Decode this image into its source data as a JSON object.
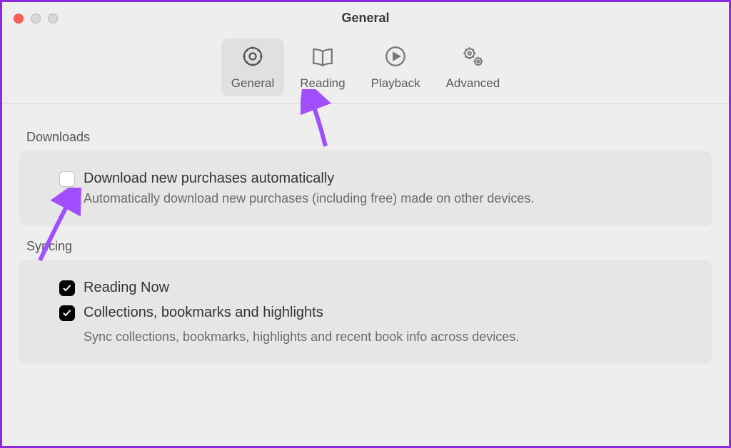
{
  "window": {
    "title": "General"
  },
  "tabs": {
    "general": "General",
    "reading": "Reading",
    "playback": "Playback",
    "advanced": "Advanced"
  },
  "sections": {
    "downloads": {
      "title": "Downloads",
      "option": "Download new purchases automatically",
      "description": "Automatically download new purchases (including free) made on other devices."
    },
    "syncing": {
      "title": "Syncing",
      "readingNow": "Reading Now",
      "collections": "Collections, bookmarks and highlights",
      "description": "Sync collections, bookmarks, highlights and recent book info across devices."
    }
  },
  "annotation": {
    "arrowColor": "#a04eff"
  }
}
